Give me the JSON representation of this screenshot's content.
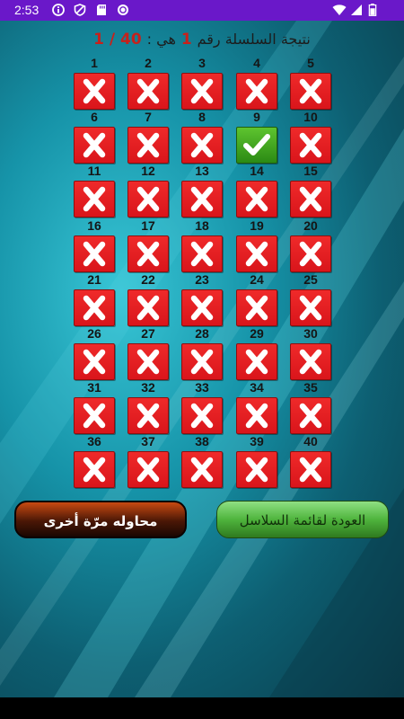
{
  "status_bar": {
    "time": "2:53",
    "icons": [
      "info-icon",
      "shield-icon",
      "sd-card-icon",
      "sync-icon"
    ],
    "right_icons": [
      "wifi-icon",
      "signal-icon",
      "battery-icon"
    ]
  },
  "header": {
    "label": "نتيجة السلسلة رقم",
    "series_number": "1",
    "is_label": "هي :",
    "score_text": "1 / 40"
  },
  "results": [
    {
      "n": "1",
      "ok": false
    },
    {
      "n": "2",
      "ok": false
    },
    {
      "n": "3",
      "ok": false
    },
    {
      "n": "4",
      "ok": false
    },
    {
      "n": "5",
      "ok": false
    },
    {
      "n": "6",
      "ok": false
    },
    {
      "n": "7",
      "ok": false
    },
    {
      "n": "8",
      "ok": false
    },
    {
      "n": "9",
      "ok": true
    },
    {
      "n": "10",
      "ok": false
    },
    {
      "n": "11",
      "ok": false
    },
    {
      "n": "12",
      "ok": false
    },
    {
      "n": "13",
      "ok": false
    },
    {
      "n": "14",
      "ok": false
    },
    {
      "n": "15",
      "ok": false
    },
    {
      "n": "16",
      "ok": false
    },
    {
      "n": "17",
      "ok": false
    },
    {
      "n": "18",
      "ok": false
    },
    {
      "n": "19",
      "ok": false
    },
    {
      "n": "20",
      "ok": false
    },
    {
      "n": "21",
      "ok": false
    },
    {
      "n": "22",
      "ok": false
    },
    {
      "n": "23",
      "ok": false
    },
    {
      "n": "24",
      "ok": false
    },
    {
      "n": "25",
      "ok": false
    },
    {
      "n": "26",
      "ok": false
    },
    {
      "n": "27",
      "ok": false
    },
    {
      "n": "28",
      "ok": false
    },
    {
      "n": "29",
      "ok": false
    },
    {
      "n": "30",
      "ok": false
    },
    {
      "n": "31",
      "ok": false
    },
    {
      "n": "32",
      "ok": false
    },
    {
      "n": "33",
      "ok": false
    },
    {
      "n": "34",
      "ok": false
    },
    {
      "n": "35",
      "ok": false
    },
    {
      "n": "36",
      "ok": false
    },
    {
      "n": "37",
      "ok": false
    },
    {
      "n": "38",
      "ok": false
    },
    {
      "n": "39",
      "ok": false
    },
    {
      "n": "40",
      "ok": false
    }
  ],
  "buttons": {
    "retry_label": "محاوله مرّة أخرى",
    "back_label": "العودة لقائمة السلاسل"
  },
  "colors": {
    "status_bar": "#6a18c9",
    "wrong": "#e11f22",
    "correct": "#3fa623",
    "score_red": "#c7211b"
  }
}
